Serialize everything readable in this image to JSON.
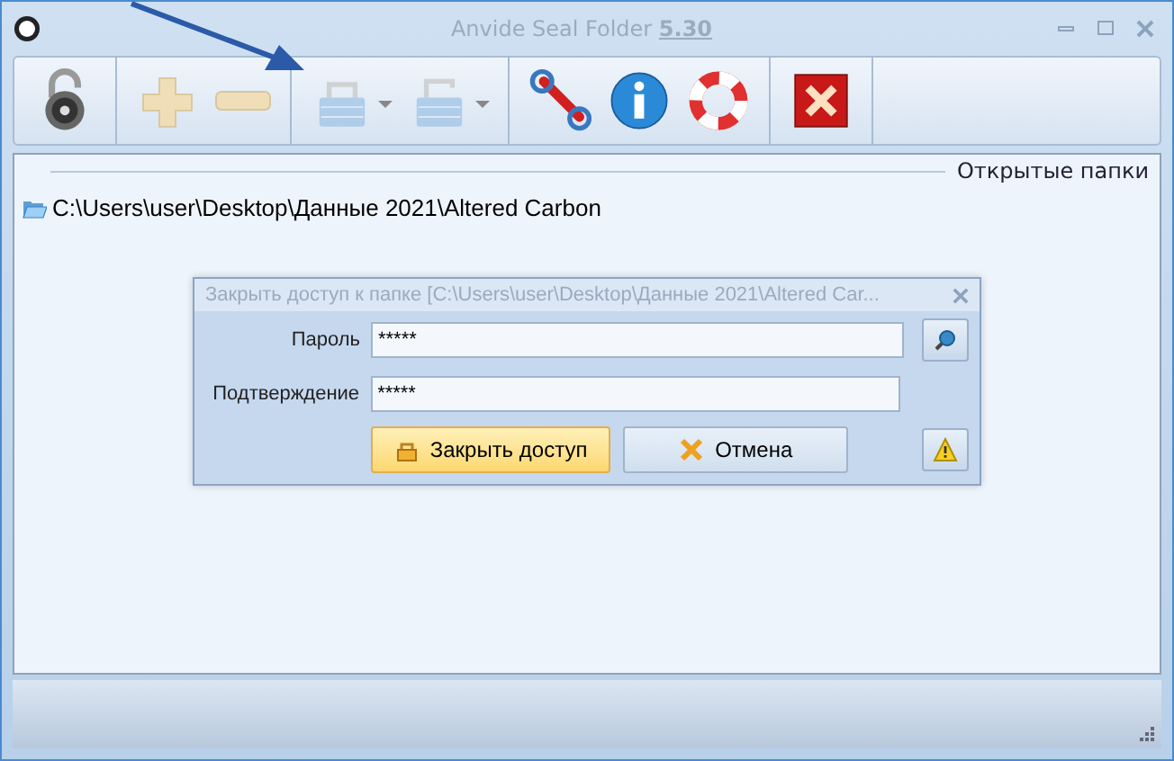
{
  "window": {
    "title": "Anvide Seal Folder",
    "version": "5.30"
  },
  "toolbar": [
    {
      "items": [
        {
          "kind": "unlock",
          "disabled": false
        }
      ]
    },
    {
      "items": [
        {
          "kind": "add",
          "disabled": true
        },
        {
          "kind": "remove",
          "disabled": true
        }
      ]
    },
    {
      "items": [
        {
          "kind": "lock-menu",
          "disabled": true
        },
        {
          "kind": "unlock-menu",
          "disabled": true
        }
      ]
    },
    {
      "items": [
        {
          "kind": "settings",
          "disabled": false
        },
        {
          "kind": "info",
          "disabled": false
        },
        {
          "kind": "help",
          "disabled": false
        }
      ]
    },
    {
      "items": [
        {
          "kind": "exit",
          "disabled": false
        }
      ]
    }
  ],
  "panel": {
    "title": "Открытые папки",
    "folders": [
      {
        "path": "C:\\Users\\user\\Desktop\\Данные 2021\\Altered Carbon",
        "selected": false
      }
    ]
  },
  "dialog": {
    "title": "Закрыть доступ к папке [C:\\Users\\user\\Desktop\\Данные 2021\\Altered Car...",
    "fields": [
      {
        "label": "Пароль",
        "value": "*****"
      },
      {
        "label": "Подтверждение",
        "value": "*****"
      }
    ],
    "buttons": [
      {
        "label": "Закрыть доступ",
        "kind": "lock",
        "primary": true
      },
      {
        "label": "Отмена",
        "kind": "cancel",
        "primary": false
      }
    ]
  }
}
